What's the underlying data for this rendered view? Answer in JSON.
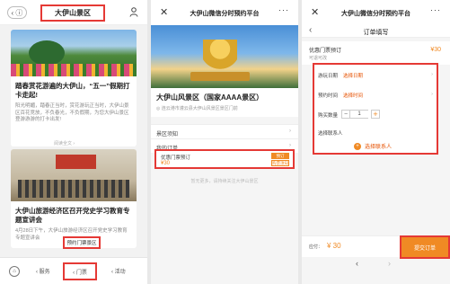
{
  "phone1": {
    "title": "大伊山景区",
    "back_label": "‹ ⓘ",
    "article1": {
      "title": "踏春赏花游遍的大伊山，“五一”假期打卡走起!",
      "desc": "阳光明媚，踏春正当时，赏花游玩正当时，大伊山景区百花竞放，不负春光，不负假期，为您大伊山景区登游游游的打卡出发!",
      "read_more": "阅读全文 ›"
    },
    "article2": {
      "title": "大伊山旅游经济区召开党史学习教育专题宣讲会",
      "desc": "4月28日下午，大伊山旅游经济区召开党史学习教育专题宣讲会"
    },
    "booking_button": "预约门票景区",
    "nav": {
      "item_left": "‹ 服务",
      "item_selected": "‹ 门票",
      "item_right": "‹ 活动"
    }
  },
  "phone2": {
    "title": "大伊山微信分时预约平台",
    "close": "✕",
    "dots": "···",
    "scenic_name": "大伊山风景区（国家AAAA景区）",
    "address": "◎ 连云港市灌云县大伊山风景区景区门前",
    "rows": [
      {
        "label": "景区须知",
        "arrow": "›"
      },
      {
        "label": "我的订单",
        "arrow": "›"
      }
    ],
    "ticket": {
      "name": "优惠门票预订",
      "price": "¥30",
      "btn1": "预订",
      "btn2": "购票须知"
    },
    "footnote": "暂无更多，请持续关注大伊山景区"
  },
  "phone3": {
    "title": "大伊山微信分时预约平台",
    "close": "✕",
    "dots": "···",
    "sub_title": "订单填写",
    "back": "‹",
    "ticket_name": "优惠门票预订",
    "ticket_sub": "可退可改",
    "ticket_price": "¥30",
    "form": {
      "date_label": "游玩日期",
      "date_value": "选择日期",
      "time_label": "预约时间",
      "time_value": "选择时间",
      "qty_label": "购买数量",
      "qty_value": "1",
      "minus": "−",
      "plus": "+",
      "visitor_label": "选择联系人",
      "add_contact": "选择联系人",
      "arrow": "›"
    },
    "total_label": "应付：",
    "total_value": "¥ 30",
    "submit": "提交订单",
    "nav_left": "‹",
    "nav_right": "›"
  }
}
